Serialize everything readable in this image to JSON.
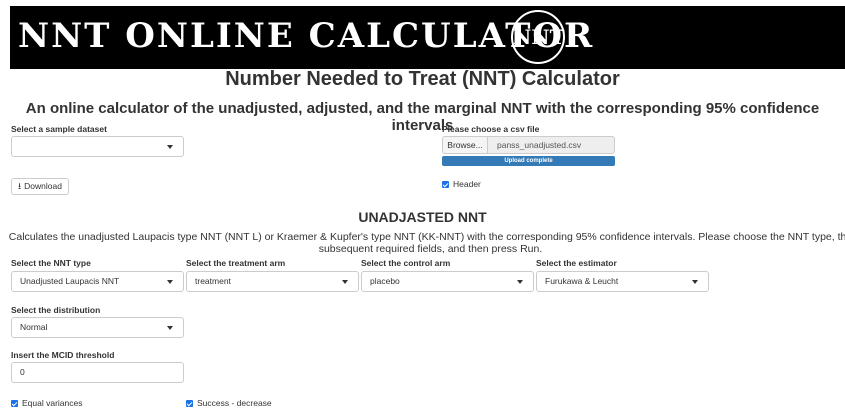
{
  "banner": {
    "title": "NNT ONLINE CALCULATOR",
    "logo_text": "NNT"
  },
  "header": {
    "title": "Number Needed to Treat (NNT) Calculator",
    "subtitle": "An online calculator of the unadjusted, adjusted, and the marginal NNT with the corresponding 95% confidence intervals"
  },
  "sample_dataset": {
    "label": "Select a sample dataset",
    "value": ""
  },
  "download_label": "Download",
  "csv": {
    "label": "Please choose a csv file",
    "browse_label": "Browse...",
    "filename": "panss_unadjusted.csv",
    "upload_status": "Upload complete",
    "upload_progress": 1.0,
    "header_label": "Header",
    "header_checked": true
  },
  "section": {
    "title": "UNADJASTED NNT",
    "description_line1": "Calculates the unadjusted Laupacis type NNT (NNT L) or Kraemer & Kupfer's type NNT (KK-NNT) with the corresponding 95% confidence intervals. Please choose the NNT type, the",
    "description_line2": "subsequent required fields, and then press Run."
  },
  "fields": {
    "nnt_type": {
      "label": "Select the NNT type",
      "value": "Unadjusted Laupacis NNT"
    },
    "treatment_arm": {
      "label": "Select the treatment arm",
      "value": "treatment"
    },
    "control_arm": {
      "label": "Select the control arm",
      "value": "placebo"
    },
    "estimator": {
      "label": "Select the estimator",
      "value": "Furukawa & Leucht"
    },
    "distribution": {
      "label": "Select the distribution",
      "value": "Normal"
    },
    "mcid": {
      "label": "Insert the MCID threshold",
      "value": "0"
    }
  },
  "checkboxes": {
    "equal_variances": {
      "label": "Equal variances",
      "checked": true
    },
    "success_decrease": {
      "label": "Success - decrease",
      "checked": true
    }
  },
  "colors": {
    "accent": "#337ab7",
    "checkbox": "#1a73e8",
    "banner_bg": "#000000"
  }
}
